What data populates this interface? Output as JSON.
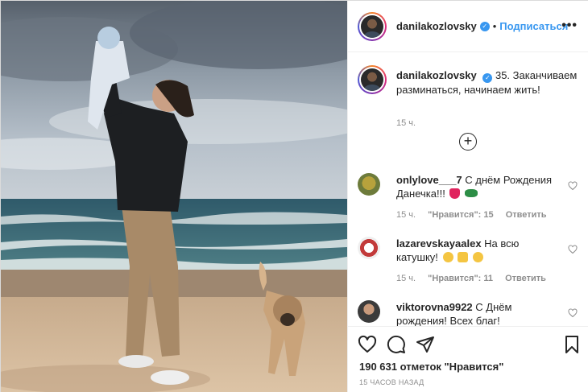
{
  "post": {
    "username": "danilakozlovsky",
    "verified_mark": "✓",
    "separator": "•",
    "follow_label": "Подписаться",
    "more_label": "•••"
  },
  "caption": {
    "username": "danilakozlovsky",
    "text": "35. Заканчиваем разминаться, начинаем жить!",
    "time": "15 ч."
  },
  "load_more_label": "+",
  "comments": [
    {
      "username": "onlylove___7",
      "text": "С днём Рождения Данечка!!!",
      "time": "15 ч.",
      "likes": "\"Нравится\": 15",
      "reply": "Ответить"
    },
    {
      "username": "lazarevskayaalex",
      "text": "На всю катушку!",
      "time": "15 ч.",
      "likes": "\"Нравится\": 11",
      "reply": "Ответить"
    },
    {
      "username": "viktorovna9922",
      "text": "С Днём рождения! Всех благ!",
      "time": "",
      "likes": "",
      "reply": ""
    }
  ],
  "footer": {
    "likes": "190 631 отметок \"Нравится\"",
    "date": "15 ЧАСОВ НАЗАД"
  },
  "icons": {
    "heart": "heart-icon",
    "comment": "comment-icon",
    "share": "paper-plane-icon",
    "save": "bookmark-icon"
  },
  "colors": {
    "link": "#3897f0",
    "muted": "#8e8e8e",
    "text": "#262626"
  }
}
